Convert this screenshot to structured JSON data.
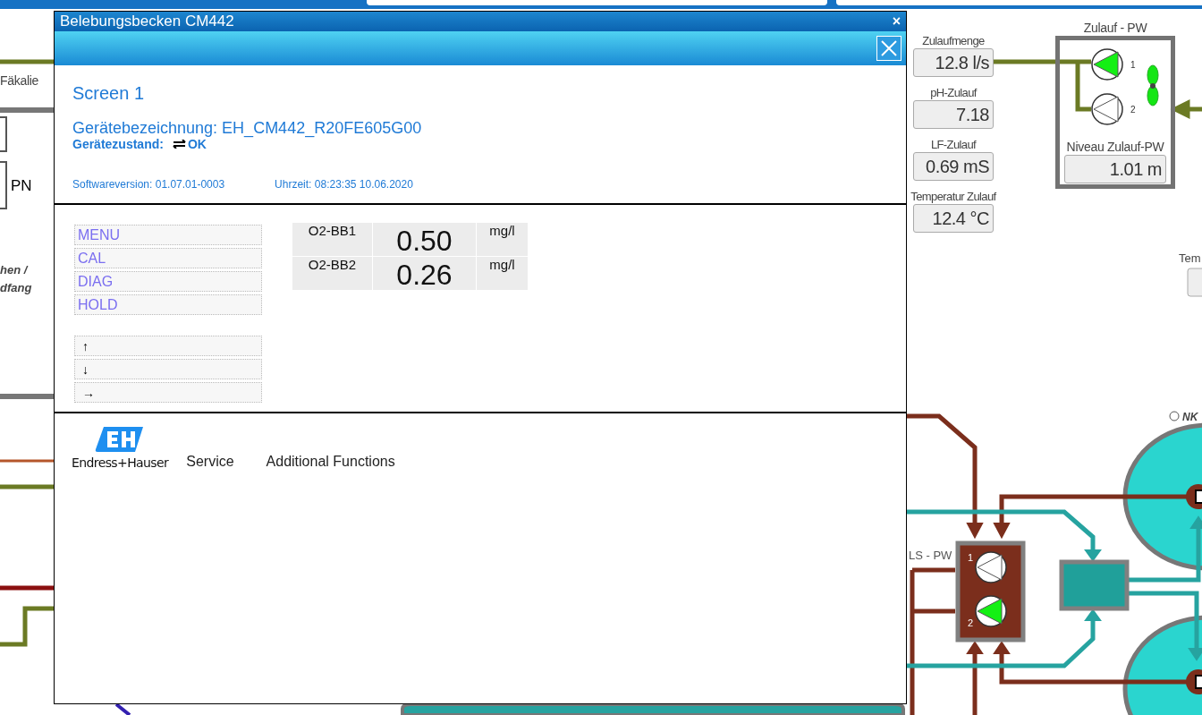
{
  "plant": {
    "left": {
      "label": "Fäkalie",
      "field_label": "PN",
      "note_lines": [
        "hen /",
        "dfang"
      ]
    },
    "readings": [
      {
        "label": "Zulaufmenge",
        "value": "12.8 l/s"
      },
      {
        "label": "pH-Zulauf",
        "value": "7.18"
      },
      {
        "label": "LF-Zulauf",
        "value": "0.69 mS"
      },
      {
        "label": "Temperatur Zulauf",
        "value": "12.4 °C"
      }
    ],
    "inlet_station": {
      "title": "Zulauf - PW",
      "pumps": [
        {
          "number": "1",
          "running": true
        },
        {
          "number": "2",
          "running": false
        }
      ],
      "fan_on": true,
      "level_label": "Niveau Zulauf-PW",
      "level_value": "1.01 m"
    },
    "lift_station": {
      "title": "LS - PW",
      "pumps": [
        {
          "number": "1",
          "running": false
        },
        {
          "number": "2",
          "running": true
        }
      ]
    },
    "temperature_label": "Tem",
    "tank_label": "NK"
  },
  "dialog": {
    "title": "Belebungsbecken CM442",
    "title_close": "×",
    "screen": "Screen 1",
    "device_name": "Gerätebezeichnung: EH_CM442_R20FE605G00",
    "status_label": "Gerätezustand:",
    "status_value": "OK",
    "software": "Softwareversion: 01.07.01-0003",
    "time": "Uhrzeit: 08:23:35 10.06.2020",
    "menu": [
      "MENU",
      "CAL",
      "DIAG",
      "HOLD"
    ],
    "nav": [
      "↑",
      "↓",
      "→"
    ],
    "measurements": [
      {
        "name": "O2-BB1",
        "value": "0.50",
        "unit": "mg/l"
      },
      {
        "name": "O2-BB2",
        "value": "0.26",
        "unit": "mg/l"
      }
    ],
    "footer": {
      "brand": "Endress+Hauser",
      "links": [
        "Service",
        "Additional Functions"
      ]
    }
  }
}
